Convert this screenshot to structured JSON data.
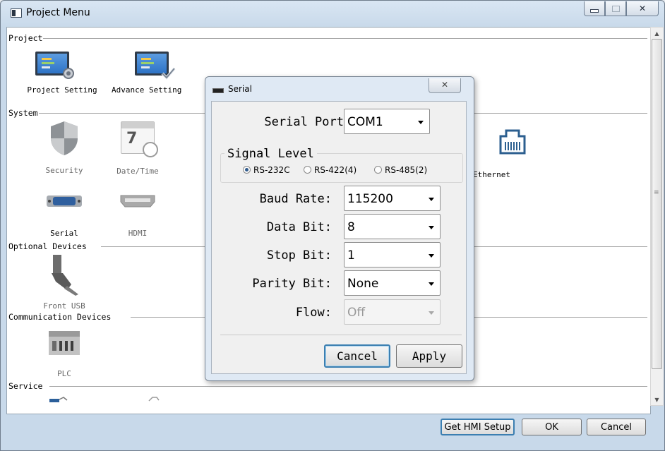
{
  "window": {
    "title": "Project Menu"
  },
  "sections": {
    "project": "Project",
    "system": "System",
    "optional": "Optional Devices",
    "communication": "Communication Devices",
    "service": "Service"
  },
  "items": {
    "project_setting": "Project Setting",
    "advance_setting": "Advance Setting",
    "security": "Security",
    "date_time": "Date/Time",
    "ethernet": "Ethernet",
    "serial": "Serial",
    "hdmi": "HDMI",
    "front_usb": "Front USB",
    "plc": "PLC"
  },
  "dialog": {
    "title": "Serial",
    "serial_port_label": "Serial Port",
    "serial_port_value": "COM1",
    "signal_level_label": "Signal Level",
    "signal_options": [
      {
        "label": "RS-232C",
        "selected": true
      },
      {
        "label": "RS-422(4)",
        "selected": false
      },
      {
        "label": "RS-485(2)",
        "selected": false
      }
    ],
    "baud_rate_label": "Baud Rate:",
    "baud_rate_value": "115200",
    "data_bit_label": "Data Bit:",
    "data_bit_value": "8",
    "stop_bit_label": "Stop Bit:",
    "stop_bit_value": "1",
    "parity_bit_label": "Parity Bit:",
    "parity_bit_value": "None",
    "flow_label": "Flow:",
    "flow_value": "Off",
    "cancel_label": "Cancel",
    "apply_label": "Apply"
  },
  "footer": {
    "get_hmi_setup": "Get HMI Setup",
    "ok": "OK",
    "cancel": "Cancel"
  }
}
